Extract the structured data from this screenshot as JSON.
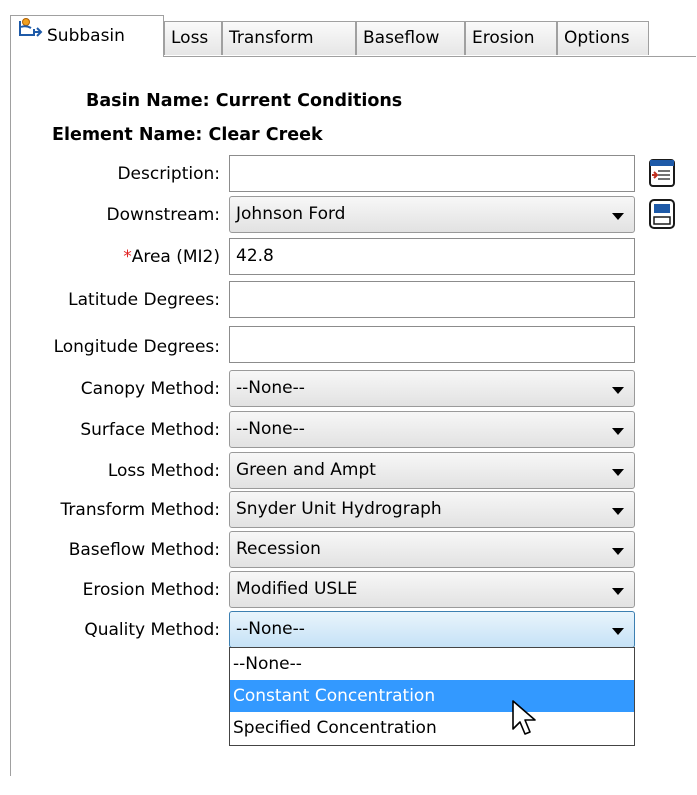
{
  "tabs": [
    {
      "label": "Subbasin",
      "active": true,
      "icon": "subbasin-icon"
    },
    {
      "label": "Loss"
    },
    {
      "label": "Transform"
    },
    {
      "label": "Baseflow"
    },
    {
      "label": "Erosion"
    },
    {
      "label": "Options"
    }
  ],
  "header": {
    "basin_label": "Basin Name:",
    "basin_value": "Current Conditions",
    "element_label": "Element Name:",
    "element_value": "Clear Creek"
  },
  "fields": {
    "description": {
      "label": "Description:",
      "value": ""
    },
    "downstream": {
      "label": "Downstream:",
      "value": "Johnson Ford"
    },
    "area": {
      "required_mark": "*",
      "label": "Area (MI2)",
      "value": "42.8"
    },
    "latitude": {
      "label": "Latitude Degrees:",
      "value": ""
    },
    "longitude": {
      "label": "Longitude Degrees:",
      "value": ""
    },
    "canopy": {
      "label": "Canopy Method:",
      "value": "--None--"
    },
    "surface": {
      "label": "Surface Method:",
      "value": "--None--"
    },
    "loss": {
      "label": "Loss Method:",
      "value": "Green and Ampt"
    },
    "transform": {
      "label": "Transform Method:",
      "value": "Snyder Unit Hydrograph"
    },
    "baseflow": {
      "label": "Baseflow Method:",
      "value": "Recession"
    },
    "erosion": {
      "label": "Erosion Method:",
      "value": "Modified USLE"
    },
    "quality": {
      "label": "Quality Method:",
      "value": "--None--"
    }
  },
  "quality_dropdown": {
    "options": [
      "--None--",
      "Constant Concentration",
      "Specified Concentration"
    ],
    "highlighted": "Constant Concentration"
  },
  "colors": {
    "selection": "#3399ff",
    "required": "#e02020"
  }
}
